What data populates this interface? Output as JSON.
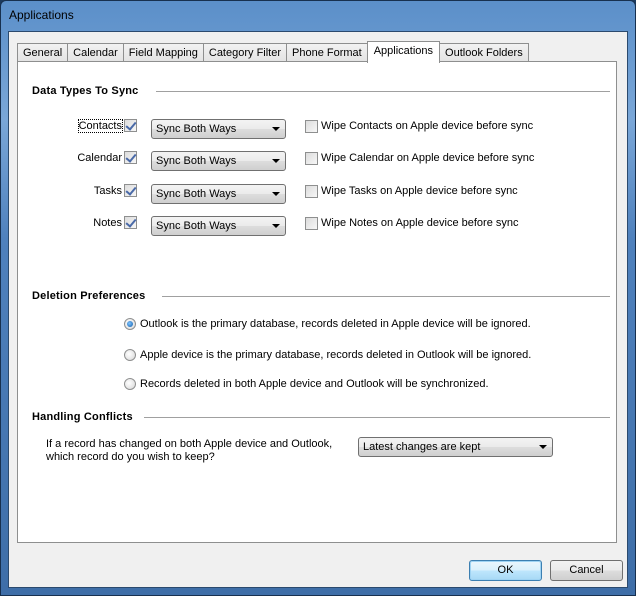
{
  "window": {
    "title": "Applications"
  },
  "tabs": [
    {
      "label": "General",
      "active": false
    },
    {
      "label": "Calendar",
      "active": false
    },
    {
      "label": "Field Mapping",
      "active": false
    },
    {
      "label": "Category Filter",
      "active": false
    },
    {
      "label": "Phone Format",
      "active": false
    },
    {
      "label": "Applications",
      "active": true
    },
    {
      "label": "Outlook Folders",
      "active": false
    }
  ],
  "data_types": {
    "title": "Data Types To Sync",
    "rows": [
      {
        "label": "Contacts",
        "checked": true,
        "sync_mode": "Sync Both Ways",
        "wipe_label": "Wipe Contacts on Apple device before sync",
        "wipe_checked": false
      },
      {
        "label": "Calendar",
        "checked": true,
        "sync_mode": "Sync Both Ways",
        "wipe_label": "Wipe Calendar on Apple device before sync",
        "wipe_checked": false
      },
      {
        "label": "Tasks",
        "checked": true,
        "sync_mode": "Sync Both Ways",
        "wipe_label": "Wipe Tasks on Apple device before sync",
        "wipe_checked": false
      },
      {
        "label": "Notes",
        "checked": true,
        "sync_mode": "Sync Both Ways",
        "wipe_label": "Wipe Notes on Apple device before sync",
        "wipe_checked": false
      }
    ]
  },
  "deletion": {
    "title": "Deletion Preferences",
    "options": [
      {
        "label": "Outlook is the primary database, records deleted in Apple device will be ignored.",
        "selected": true
      },
      {
        "label": "Apple device is the primary database, records deleted in Outlook will be ignored.",
        "selected": false
      },
      {
        "label": "Records deleted in both Apple device and Outlook will be synchronized.",
        "selected": false
      }
    ]
  },
  "conflicts": {
    "title": "Handling Conflicts",
    "question_line1": "If a record has changed on both Apple device and Outlook,",
    "question_line2": "which record do you wish to keep?",
    "selected": "Latest changes are kept"
  },
  "buttons": {
    "ok": "OK",
    "cancel": "Cancel"
  }
}
